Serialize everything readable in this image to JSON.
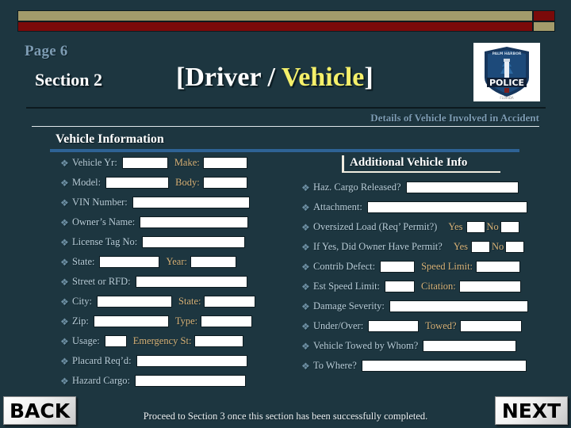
{
  "header": {
    "page_label": "Page 6",
    "section_label": "Section 2",
    "title_open": "[Driver / ",
    "title_highlight": "Vehicle",
    "title_close": "]",
    "subtitle": "Details of Vehicle Involved in Accident",
    "badge_name": "police-badge-logo",
    "badge_text_top": "PALM HARBOR",
    "badge_text_main": "POLICE"
  },
  "left_panel": {
    "heading": "Vehicle Information",
    "rows": [
      {
        "bullet": "❖",
        "label": "Vehicle Yr:",
        "field_w": 58,
        "label2": "Make:",
        "label2_gold": true,
        "field2_w": 56
      },
      {
        "bullet": "❖",
        "label": "Model:",
        "field_w": 80,
        "label2": "Body:",
        "label2_gold": true,
        "field2_w": 56
      },
      {
        "bullet": "❖",
        "label": "VIN Number:",
        "field_w": 148
      },
      {
        "bullet": "❖",
        "label": "Owner’s Name:",
        "field_w": 137
      },
      {
        "bullet": "❖",
        "label": "License Tag No:",
        "field_w": 130
      },
      {
        "bullet": "❖",
        "label": "State:",
        "field_w": 76,
        "label2": "Year:",
        "label2_gold": true,
        "field2_w": 58
      },
      {
        "bullet": "❖",
        "label": "Street or RFD:",
        "field_w": 141
      },
      {
        "bullet": "❖",
        "label": "City:",
        "field_w": 95,
        "label2": "State:",
        "label2_gold": true,
        "field2_w": 65
      },
      {
        "bullet": "❖",
        "label": "Zip:",
        "field_w": 95,
        "label2": "Type:",
        "label2_gold": true,
        "field2_w": 65
      },
      {
        "bullet": "❖",
        "label": "Usage:",
        "field_w": 28,
        "label2": "Emergency St:",
        "label2_gold": true,
        "field2_w": 62
      },
      {
        "bullet": "❖",
        "label": "Placard Req’d:",
        "field_w": 140
      },
      {
        "bullet": "❖",
        "label": "Hazard Cargo:",
        "field_w": 140
      }
    ]
  },
  "right_panel": {
    "heading": "Additional Vehicle Info",
    "rows": [
      {
        "bullet": "❖",
        "label": "Haz. Cargo Released?",
        "field_w": 142
      },
      {
        "bullet": "❖",
        "label": "Attachment:",
        "field_w": 202
      },
      {
        "bullet": "❖",
        "label": "Oversized Load (Req’ Permit?)",
        "label2": "Yes",
        "label2_gold": true,
        "field2_w": 24,
        "label3": "No",
        "label3_gold": true,
        "field3_w": 24
      },
      {
        "bullet": "❖",
        "label": "If Yes, Did Owner Have Permit?",
        "label2": "Yes",
        "label2_gold": true,
        "field2_w": 24,
        "label3": "No",
        "label3_gold": true,
        "field3_w": 24
      },
      {
        "bullet": "❖",
        "label": "Contrib Defect:",
        "field_w": 44,
        "label2": "Speed Limit:",
        "label2_gold": true,
        "field2_w": 56
      },
      {
        "bullet": "❖",
        "label": "Est Speed Limit:",
        "field_w": 38,
        "label2": "Citation:",
        "label2_gold": true,
        "field2_w": 78
      },
      {
        "bullet": "❖",
        "label": "Damage Severity:",
        "field_w": 175
      },
      {
        "bullet": "❖",
        "label": "Under/Over:",
        "field_w": 64,
        "label2": "Towed?",
        "label2_gold": true,
        "field2_w": 78
      },
      {
        "bullet": "❖",
        "label": "Vehicle Towed by Whom?",
        "field_w": 118
      },
      {
        "bullet": "❖",
        "label": "To Where?",
        "field_w": 208
      }
    ]
  },
  "footer": {
    "note": "Proceed to Section 3 once this section has been successfully completed.",
    "back_label": "BACK",
    "next_label": "NEXT"
  },
  "colors": {
    "background": "#1d3640",
    "banner_tan": "#a39b6b",
    "banner_red": "#7b0a0a",
    "accent_blue_bar": "#2e6395",
    "label_blue": "#b9cdd8",
    "label_gold": "#d8b277",
    "title_highlight": "#f5f06a"
  }
}
